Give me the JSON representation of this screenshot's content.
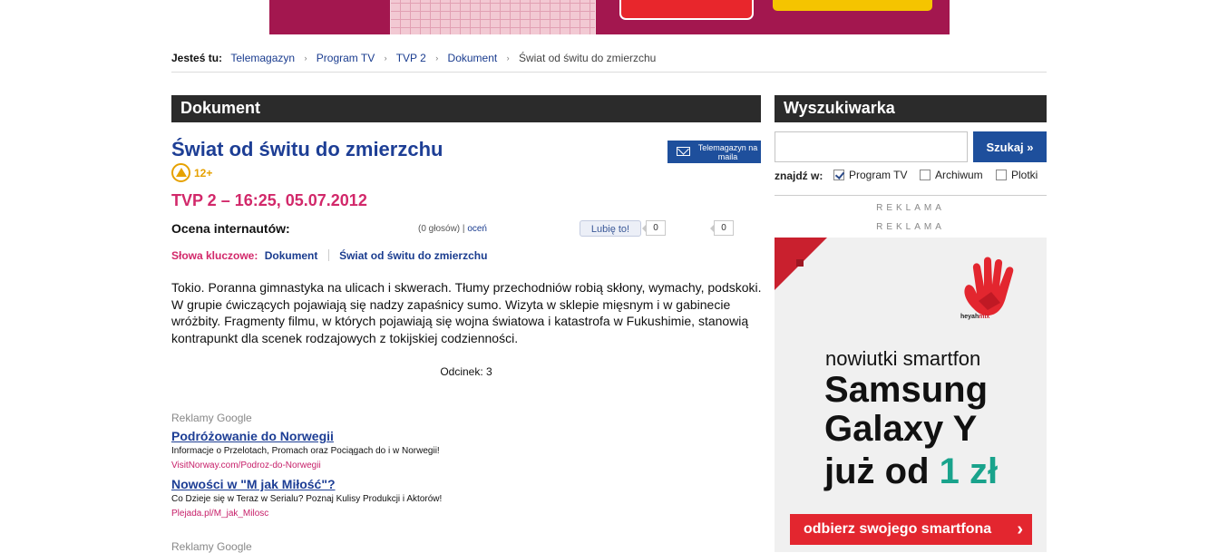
{
  "breadcrumb": {
    "lead": "Jesteś tu:",
    "items": [
      "Telemagazyn",
      "Program TV",
      "TVP 2",
      "Dokument"
    ],
    "current": "Świat od świtu do zmierzchu"
  },
  "main": {
    "section_title": "Dokument",
    "title": "Świat od świtu do zmierzchu",
    "newsletter_label": "Telemagazyn na maila",
    "age_rating": "12+",
    "broadcast": "TVP 2 – 16:25, 05.07.2012",
    "rating_label": "Ocena internautów:",
    "votes": "(0 głosów)",
    "votes_sep": "|",
    "rate_link": "oceń",
    "like_label": "Lubię to!",
    "like_count": "0",
    "share_count": "0",
    "keywords_label": "Słowa kluczowe:",
    "keywords": [
      "Dokument",
      "Świat od świtu do zmierzchu"
    ],
    "description": "Tokio. Poranna gimnastyka na ulicach i skwerach. Tłumy przechodniów robią skłony, wymachy, podskoki. W grupie ćwiczących pojawiają się nadzy zapaśnicy sumo. Wizyta w sklepie mięsnym i w gabinecie wróżbity. Fragmenty filmu, w których pojawiają się wojna światowa i katastrofa w Fukushimie, stanowią kontrapunkt dla scenek rodzajowych z tokijskiej codzienności.",
    "episode": "Odcinek: 3"
  },
  "google_ads": {
    "label": "Reklamy Google",
    "items": [
      {
        "title": "Podróżowanie do Norwegii",
        "desc": "Informacje o Przelotach, Promach oraz Pociągach do i w Norwegii!",
        "url": "VisitNorway.com/Podroz-do-Norwegii"
      },
      {
        "title": "Nowości w \"M jak Miłość\"?",
        "desc": "Co Dzieje się w Teraz w Serialu? Poznaj Kulisy Produkcji i Aktorów!",
        "url": "Plejada.pl/M_jak_Milosc"
      }
    ],
    "label2": "Reklamy Google"
  },
  "sidebar": {
    "section_title": "Wyszukiwarka",
    "search_placeholder": "",
    "search_button": "Szukaj »",
    "find_in_label": "znajdź w:",
    "filters": [
      {
        "label": "Program TV",
        "checked": true
      },
      {
        "label": "Archiwum",
        "checked": false
      },
      {
        "label": "Plotki",
        "checked": false
      }
    ],
    "ad_label_1": "REKLAMA",
    "ad_label_2": "REKLAMA"
  },
  "side_ad": {
    "brand_prefix": "heyah",
    "brand_suffix": "mix",
    "line1": "nowiutki smartfon",
    "line2": "Samsung",
    "line3": "Galaxy Y",
    "line4_prefix": "już od",
    "line4_price": "1 zł",
    "cta": "odbierz swojego smartfona",
    "cta_chevron": "›",
    "accent": "#e3262f",
    "price_color": "#19a38c"
  },
  "colors": {
    "title_blue": "#1d3e95",
    "accent_pink": "#d2286a",
    "section_bar": "#2b2b2b",
    "button_blue": "#1e4f9c"
  }
}
